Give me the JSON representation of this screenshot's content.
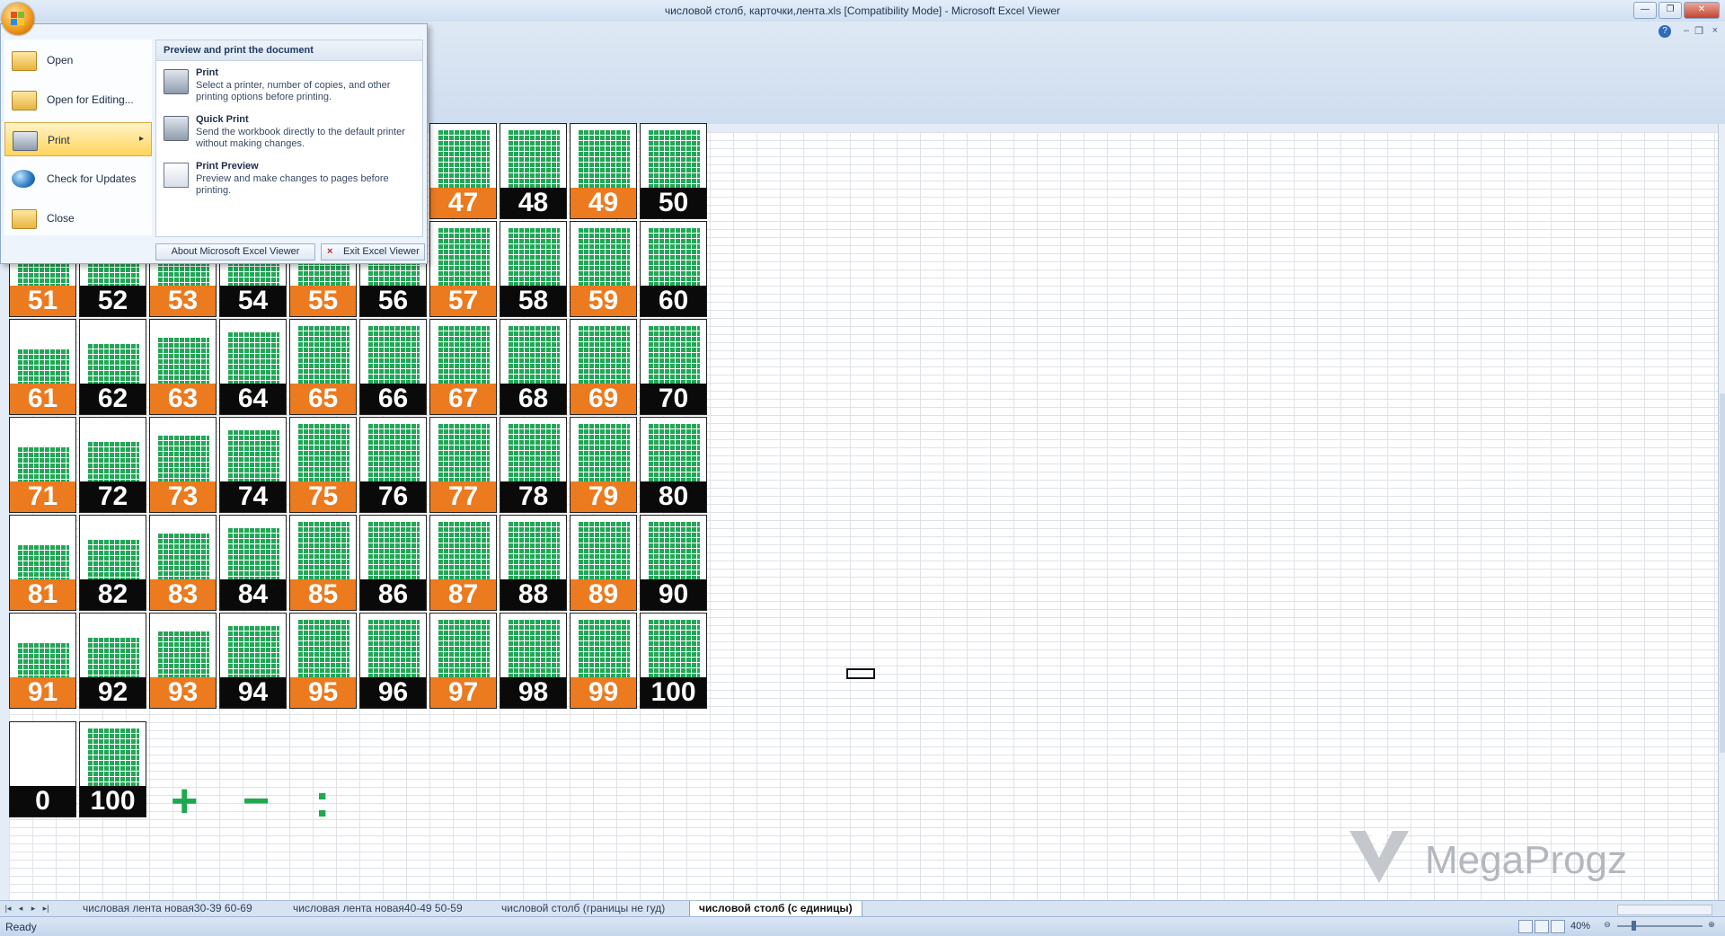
{
  "window": {
    "title": "числовой столб, карточки,лента.xls  [Compatibility Mode] - Microsoft Excel Viewer",
    "minimize": "—",
    "maximize": "❐",
    "close": "✕"
  },
  "office_menu": {
    "items": [
      {
        "label": "Open",
        "icon": "folder-open-icon"
      },
      {
        "label": "Open for Editing...",
        "icon": "folder-edit-icon"
      },
      {
        "label": "Print",
        "icon": "printer-icon",
        "highlighted": true
      },
      {
        "label": "Check for Updates",
        "icon": "globe-update-icon"
      },
      {
        "label": "Close",
        "icon": "folder-close-icon"
      }
    ],
    "submenu_title": "Preview and print the document",
    "submenu": [
      {
        "title": "Print",
        "desc": "Select a printer, number of copies, and other printing options before printing.",
        "icon": "printer-icon"
      },
      {
        "title": "Quick Print",
        "desc": "Send the workbook directly to the default printer without making changes.",
        "icon": "quick-print-icon"
      },
      {
        "title": "Print Preview",
        "desc": "Preview and make changes to pages before printing.",
        "icon": "print-preview-icon"
      }
    ],
    "about_label": "About Microsoft Excel Viewer",
    "exit_label": "Exit Excel Viewer"
  },
  "cards": [
    {
      "n": "47",
      "c": "orange"
    },
    {
      "n": "48",
      "c": "black"
    },
    {
      "n": "49",
      "c": "orange"
    },
    {
      "n": "50",
      "c": "black"
    },
    {
      "n": "51",
      "c": "orange"
    },
    {
      "n": "52",
      "c": "black"
    },
    {
      "n": "53",
      "c": "orange"
    },
    {
      "n": "54",
      "c": "black"
    },
    {
      "n": "55",
      "c": "orange"
    },
    {
      "n": "56",
      "c": "black"
    },
    {
      "n": "57",
      "c": "orange"
    },
    {
      "n": "58",
      "c": "black"
    },
    {
      "n": "59",
      "c": "orange"
    },
    {
      "n": "60",
      "c": "black"
    },
    {
      "n": "61",
      "c": "orange"
    },
    {
      "n": "62",
      "c": "black"
    },
    {
      "n": "63",
      "c": "orange"
    },
    {
      "n": "64",
      "c": "black"
    },
    {
      "n": "65",
      "c": "orange"
    },
    {
      "n": "66",
      "c": "black"
    },
    {
      "n": "67",
      "c": "orange"
    },
    {
      "n": "68",
      "c": "black"
    },
    {
      "n": "69",
      "c": "orange"
    },
    {
      "n": "70",
      "c": "black"
    },
    {
      "n": "71",
      "c": "orange"
    },
    {
      "n": "72",
      "c": "black"
    },
    {
      "n": "73",
      "c": "orange"
    },
    {
      "n": "74",
      "c": "black"
    },
    {
      "n": "75",
      "c": "orange"
    },
    {
      "n": "76",
      "c": "black"
    },
    {
      "n": "77",
      "c": "orange"
    },
    {
      "n": "78",
      "c": "black"
    },
    {
      "n": "79",
      "c": "orange"
    },
    {
      "n": "80",
      "c": "black"
    },
    {
      "n": "81",
      "c": "orange"
    },
    {
      "n": "82",
      "c": "black"
    },
    {
      "n": "83",
      "c": "orange"
    },
    {
      "n": "84",
      "c": "black"
    },
    {
      "n": "85",
      "c": "orange"
    },
    {
      "n": "86",
      "c": "black"
    },
    {
      "n": "87",
      "c": "orange"
    },
    {
      "n": "88",
      "c": "black"
    },
    {
      "n": "89",
      "c": "orange"
    },
    {
      "n": "90",
      "c": "black"
    },
    {
      "n": "91",
      "c": "orange"
    },
    {
      "n": "92",
      "c": "black"
    },
    {
      "n": "93",
      "c": "orange"
    },
    {
      "n": "94",
      "c": "black"
    },
    {
      "n": "95",
      "c": "orange"
    },
    {
      "n": "96",
      "c": "black"
    },
    {
      "n": "97",
      "c": "orange"
    },
    {
      "n": "98",
      "c": "black"
    },
    {
      "n": "99",
      "c": "orange"
    },
    {
      "n": "100",
      "c": "black"
    }
  ],
  "extra_cards": [
    {
      "n": "0",
      "c": "black"
    },
    {
      "n": "100",
      "c": "black"
    }
  ],
  "symbols": [
    "+",
    "−",
    ":"
  ],
  "sheet_tabs": [
    "числовая лента новая30-39 60-69",
    "числовая лента новая40-49 50-59",
    "числовой столб (границы не гуд)",
    "числовой столб (с единицы)"
  ],
  "status": {
    "text": "Ready",
    "zoom": "40%"
  },
  "watermark": {
    "text": "MegaProgz"
  },
  "colors": {
    "orange": "#ec7a1e",
    "black": "#0a0a0a",
    "green": "#22a757"
  }
}
